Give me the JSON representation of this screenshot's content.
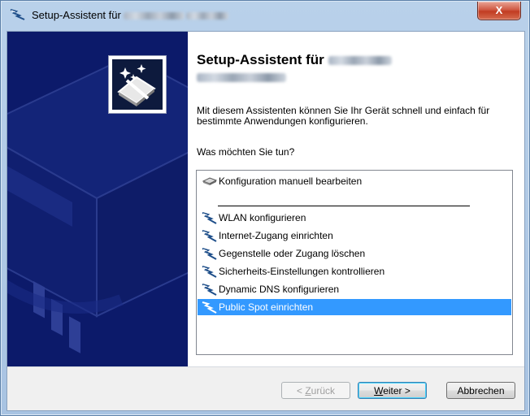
{
  "window": {
    "title": "Setup-Assistent für",
    "close_label": "X"
  },
  "content": {
    "heading": "Setup-Assistent für",
    "description": "Mit diesem Assistenten können Sie Ihr Gerät schnell und einfach für bestimmte Anwendungen konfigurieren.",
    "question": "Was möchten Sie tun?"
  },
  "options": [
    {
      "label": "Konfiguration manuell bearbeiten",
      "icon": "device-icon"
    },
    {
      "label": "WLAN konfigurieren",
      "icon": "wand-icon"
    },
    {
      "label": "Internet-Zugang einrichten",
      "icon": "wand-icon"
    },
    {
      "label": "Gegenstelle oder Zugang löschen",
      "icon": "wand-icon"
    },
    {
      "label": "Sicherheits-Einstellungen kontrollieren",
      "icon": "wand-icon"
    },
    {
      "label": "Dynamic DNS konfigurieren",
      "icon": "wand-icon"
    },
    {
      "label": "Public Spot einrichten",
      "icon": "wand-icon",
      "selected": true
    }
  ],
  "buttons": {
    "back_prefix": "< ",
    "back_mnemonic": "Z",
    "back_rest": "urück",
    "next_mnemonic": "W",
    "next_rest": "eiter >",
    "cancel": "Abbrechen"
  },
  "colors": {
    "banner": "#0c1a6a",
    "selection": "#3399ff"
  }
}
